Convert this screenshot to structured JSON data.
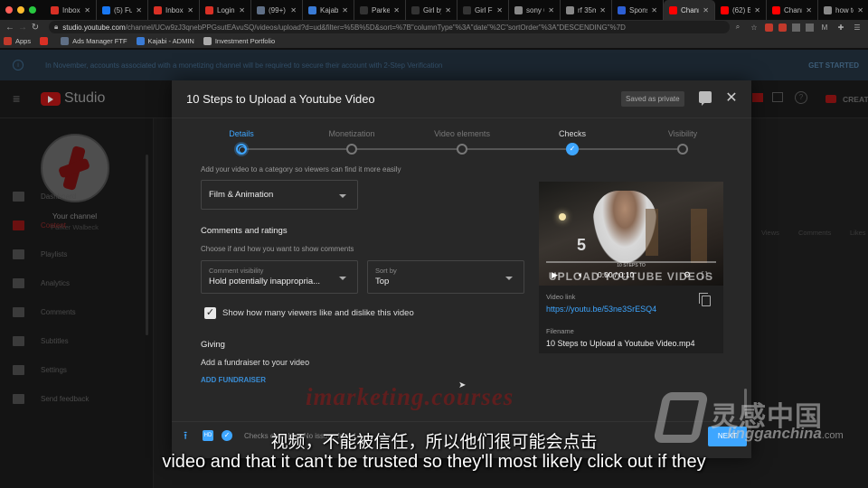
{
  "browser": {
    "tabs": [
      {
        "label": "Inbox (",
        "icon": "gmail-icon",
        "color": "#d93025"
      },
      {
        "label": "(5) Ful",
        "icon": "facebook-icon",
        "color": "#1877f2"
      },
      {
        "label": "Inbox (",
        "icon": "gmail-icon",
        "color": "#d93025"
      },
      {
        "label": "Login",
        "icon": "gmail-icon",
        "color": "#d93025"
      },
      {
        "label": "(99+)",
        "icon": "page-icon",
        "color": "#5f6f86"
      },
      {
        "label": "Kajabi",
        "icon": "kajabi-icon",
        "color": "#3a7bd5"
      },
      {
        "label": "Parker",
        "icon": "x-icon",
        "color": "#333333"
      },
      {
        "label": "Girl by",
        "icon": "dash-icon",
        "color": "#333333"
      },
      {
        "label": "Girl Fr",
        "icon": "dash-icon",
        "color": "#333333"
      },
      {
        "label": "sony 6",
        "icon": "google-icon",
        "color": "#888888"
      },
      {
        "label": "rf 35m",
        "icon": "google-icon",
        "color": "#888888"
      },
      {
        "label": "Sponso",
        "icon": "dropbox-icon",
        "color": "#2d5fd3"
      },
      {
        "label": "Channe",
        "icon": "youtube-icon",
        "color": "#ff0000",
        "active": true
      },
      {
        "label": "(62) Be",
        "icon": "youtube-icon",
        "color": "#ff0000"
      },
      {
        "label": "Channe",
        "icon": "youtube-icon",
        "color": "#ff0000"
      },
      {
        "label": "how to",
        "icon": "google-icon",
        "color": "#888888"
      }
    ],
    "url_domain": "studio.youtube.com",
    "url_path": "/channel/UCw9zJ3qnebPPGsutEAvuSQ/videos/upload?d=ud&filter=%5B%5D&sort=%7B\"columnType\"%3A\"date\"%2C\"sortOrder\"%3A\"DESCENDING\"%7D",
    "bookmarks": [
      {
        "label": "Apps",
        "icon": "apps-grid-icon",
        "color": "#c0392b"
      },
      {
        "label": "",
        "icon": "gmail-icon",
        "color": "#d93025"
      },
      {
        "label": "Ads Manager FTF",
        "icon": "page-icon",
        "color": "#5f6f86"
      },
      {
        "label": "Kajabi - ADMIN",
        "icon": "kajabi-icon",
        "color": "#3a7bd5"
      },
      {
        "label": "Investment Portfolio",
        "icon": "globe-icon",
        "color": "#aaaaaa"
      }
    ]
  },
  "banner": {
    "text": "In November, accounts associated with a monetizing channel will be required to secure their account with 2-Step Verification",
    "cta": "GET STARTED"
  },
  "studio": {
    "logo": "Studio",
    "create_label": "CREAT",
    "channel_label": "Your channel",
    "channel_name": "Parker Walbeck",
    "nav": [
      {
        "label": "Dashboard",
        "icon": "dashboard-icon"
      },
      {
        "label": "Content",
        "icon": "content-icon",
        "active": true
      },
      {
        "label": "Playlists",
        "icon": "playlists-icon"
      },
      {
        "label": "Analytics",
        "icon": "analytics-icon"
      },
      {
        "label": "Comments",
        "icon": "comments-icon"
      },
      {
        "label": "Subtitles",
        "icon": "subtitles-icon"
      },
      {
        "label": "Settings",
        "icon": "settings-icon"
      },
      {
        "label": "Send feedback",
        "icon": "feedback-icon"
      }
    ],
    "table_cols": [
      "Views",
      "Comments",
      "Likes"
    ]
  },
  "modal": {
    "title": "10 Steps to Upload a Youtube Video",
    "saved_badge": "Saved as private",
    "steps": [
      {
        "label": "Details",
        "state": "current"
      },
      {
        "label": "Monetization",
        "state": "todo"
      },
      {
        "label": "Video elements",
        "state": "todo"
      },
      {
        "label": "Checks",
        "state": "done"
      },
      {
        "label": "Visibility",
        "state": "todo"
      }
    ],
    "category_hint": "Add your video to a category so viewers can find it more easily",
    "category_value": "Film & Animation",
    "comments_heading": "Comments and ratings",
    "comments_hint": "Choose if and how you want to show comments",
    "comment_visibility_label": "Comment visibility",
    "comment_visibility_value": "Hold potentially inappropria...",
    "sort_by_label": "Sort by",
    "sort_by_value": "Top",
    "show_ratings_label": "Show how many viewers like and dislike this video",
    "show_ratings_checked": true,
    "giving_heading": "Giving",
    "giving_text": "Add a fundraiser to your video",
    "add_fundraiser": "ADD FUNDRAISER",
    "preview": {
      "overlay_small": "10 STEPS TO",
      "overlay_title": "UPLOAD YOUTUBE VIDEOS",
      "time": "0:00 / 0:10",
      "progress": 0.0
    },
    "video_link_label": "Video link",
    "video_link": "https://youtu.be/53ne3SrESQ4",
    "filename_label": "Filename",
    "filename": "10 Steps to Upload a Youtube Video.mp4",
    "footer_status": "Checks complete. No issues found.",
    "next_label": "NEXT"
  },
  "overlays": {
    "watermark_text": "imarketing.courses",
    "logo_cn": "灵感中国",
    "logo_en": "lingganchina",
    "logo_en_suffix": ".com",
    "subtitle_cn": "视频，不能被信任，所以他们很可能会点击",
    "subtitle_en": "video and that it can't be trusted so they'll most likely click out if they"
  }
}
